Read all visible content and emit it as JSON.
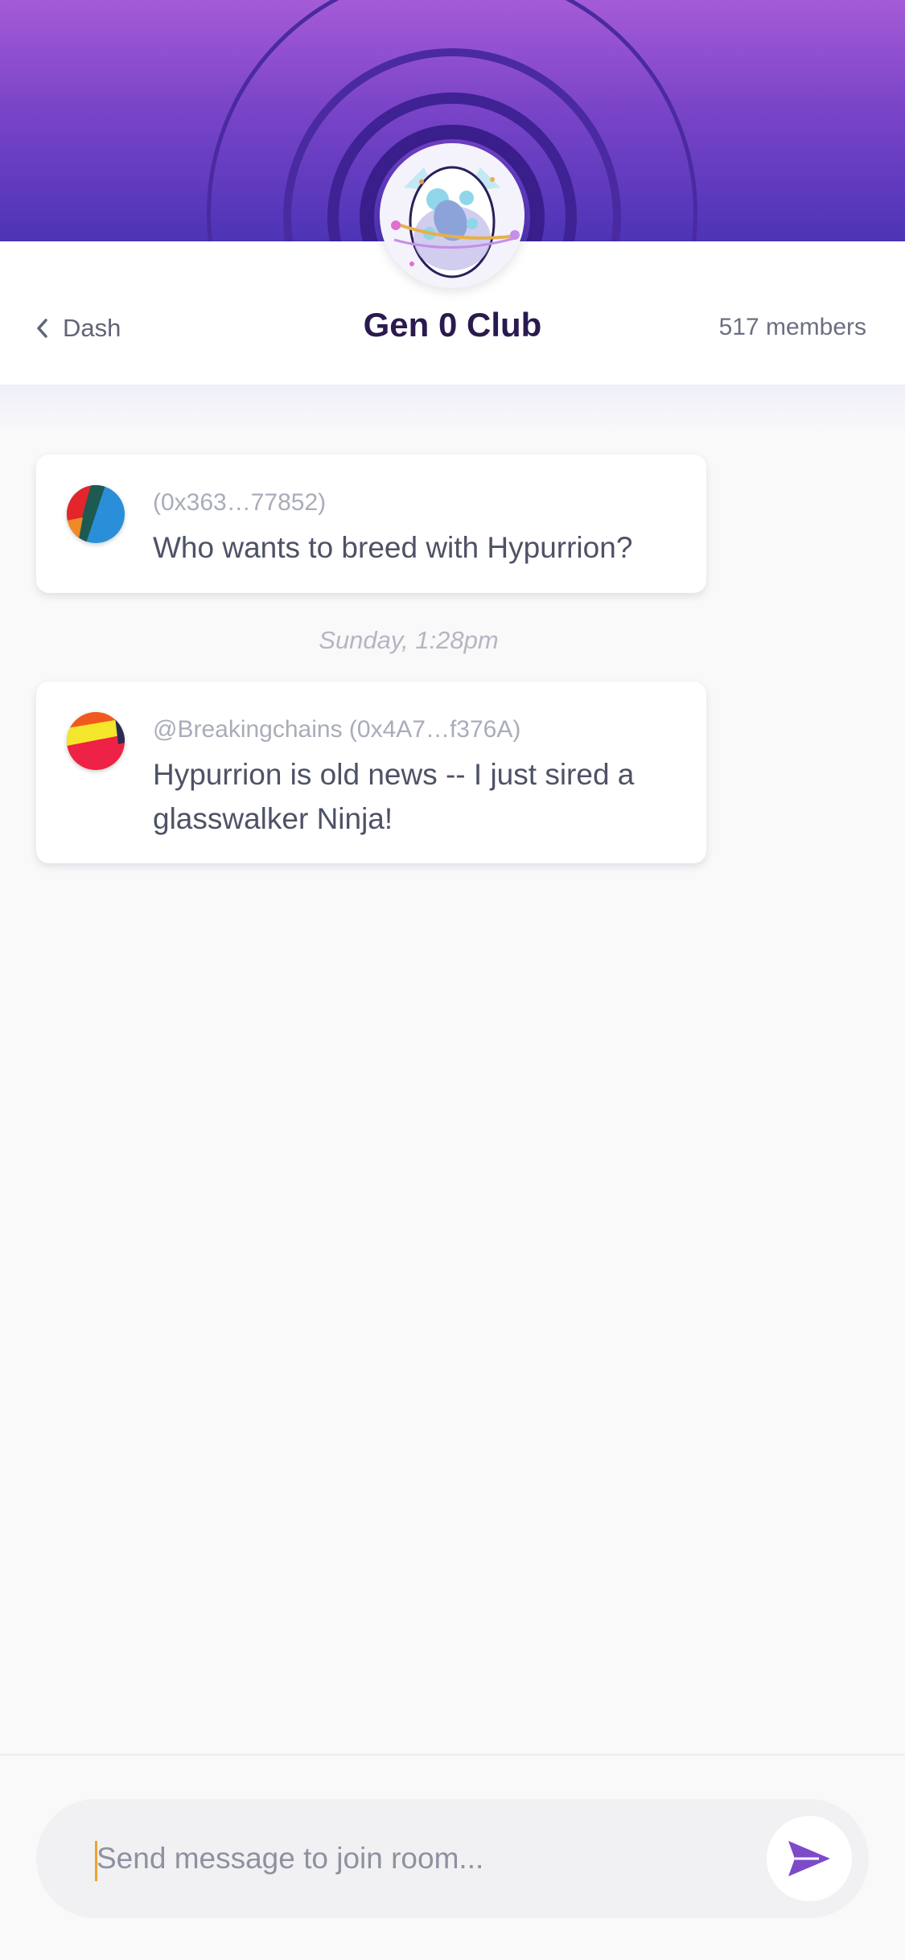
{
  "header": {
    "back_label": "Dash",
    "title": "Gen 0 Club",
    "member_count": "517 members",
    "banner_colors": {
      "top": "#a55bd6",
      "bottom": "#4d34b6",
      "rings": "#4a2aa0"
    },
    "avatar_icon": "egg-icon"
  },
  "messages": [
    {
      "author": "(0x363…77852)",
      "text": "Who wants to breed with Hypurrion?",
      "avatar_icon": "user-avatar"
    },
    {
      "author": "@Breakingchains (0x4A7…f376A)",
      "text": "Hypurrion is old news -- I just sired a glasswalker Ninja!",
      "avatar_icon": "user-avatar"
    }
  ],
  "timestamp": "Sunday, 1:28pm",
  "composer": {
    "placeholder": "Send message to join room...",
    "value": "",
    "send_icon": "send-icon",
    "accent_color": "#7d4ac8"
  }
}
